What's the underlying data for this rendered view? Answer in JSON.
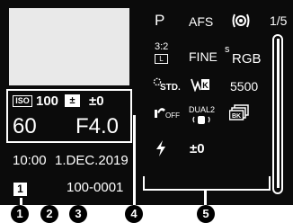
{
  "left_panel": {
    "iso_icon_text": "ISO",
    "iso_value": "100",
    "exposure_comp_value": "±0",
    "shutter_speed": "60",
    "aperture": "F4.0",
    "time": "10:00",
    "date": "1.DEC.2019",
    "card_slot": "1",
    "file_number": "100-0001"
  },
  "right_panel": {
    "page_indicator": "1/5",
    "row1": {
      "mode": "P",
      "af_mode": "AFS"
    },
    "row2": {
      "aspect_ratio": "3:2",
      "size": "L",
      "quality": "FINE",
      "color_space_sup": "s",
      "color_space": "RGB"
    },
    "row3": {
      "photo_style": "STD.",
      "wb_value": "5500"
    },
    "row4": {
      "ois_text": "OFF",
      "dual_is_text": "DUAL2"
    },
    "row5": {
      "flash_comp_value": "±0"
    }
  },
  "markers": [
    "1",
    "2",
    "3",
    "4",
    "5"
  ],
  "colors": {
    "screen_bg": "#0b0b0b",
    "thumbnail_bg": "#e9e9e9",
    "text": "#ffffff"
  }
}
